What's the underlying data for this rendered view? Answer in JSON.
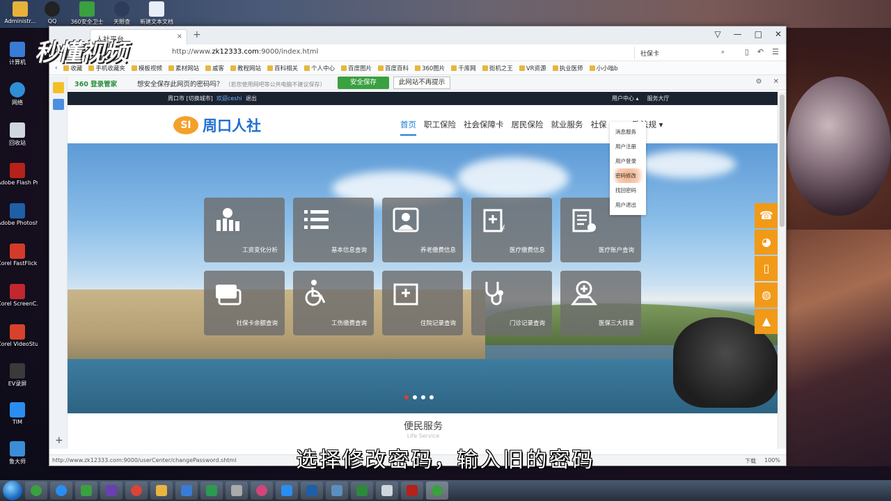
{
  "watermark": "秒懂视频",
  "subtitle": "选择修改密码，输入旧的密码",
  "desktop_icons": [
    {
      "label": "Administr...",
      "color": "#e6b23a"
    },
    {
      "label": "计算机",
      "color": "#3a7bd5"
    },
    {
      "label": "网络",
      "color": "#2e8fd6"
    },
    {
      "label": "回收站",
      "color": "#cfd6de"
    },
    {
      "label": "Adobe Flash Prof...",
      "color": "#b5211b"
    },
    {
      "label": "Adobe Photosh...",
      "color": "#1e5fa8"
    },
    {
      "label": "Corel FastFlick X9",
      "color": "#d43a2a"
    },
    {
      "label": "Corel ScreenC...",
      "color": "#c2262e"
    },
    {
      "label": "Corel VideoStud...",
      "color": "#d8412c"
    },
    {
      "label": "EV录屏",
      "color": "#3a3a3a"
    },
    {
      "label": "TIM",
      "color": "#2a8ef0"
    },
    {
      "label": "鲁大师",
      "color": "#3a8dd6"
    }
  ],
  "desktop_top_icons": [
    {
      "label": "QQ",
      "color": "#333"
    },
    {
      "label": "360安全卫士",
      "color": "#3aa040"
    },
    {
      "label": "天眼查",
      "color": "#2c3c5a"
    },
    {
      "label": "新建文本文档",
      "color": "#e8eef6"
    }
  ],
  "browser": {
    "tab_title": "人社平台",
    "url_prefix": "http://www.",
    "url_domain": "zk12333.com",
    "url_suffix": ":9000/index.html",
    "search_text": "社保卡",
    "favorites": [
      "收藏",
      "手机收藏夹",
      "模板视频",
      "素材网站",
      "戚客",
      "教程网站",
      "百科相关",
      "个人中心",
      "百度图片",
      "百度百科",
      "360图片",
      "千库网",
      "街机之王",
      "VR资源",
      "执业医师",
      "小小嗡b"
    ],
    "save_bar": {
      "brand": "360 登录管家",
      "message": "想安全保存此网页的密码吗？",
      "hint": "（若您使用网吧等公共电脑不建议保存）",
      "save_button": "安全保存",
      "dismiss_button": "此网站不再提示"
    },
    "status_url": "http://www.zk12333.com:9000/userCenter/changePassword.shtml",
    "status_right": [
      "下载",
      "100%"
    ]
  },
  "site": {
    "top_left_city": "周口市",
    "top_left_switch": "[切换城市]",
    "top_left_welcome": "欢迎",
    "top_left_user": "ceshi",
    "top_left_logout": "退出",
    "top_right_user_center": "用户中心",
    "top_right_service": "服务大厅",
    "logo_mark": "SI",
    "logo_text": "周口人社",
    "nav": [
      "首页",
      "职工保险",
      "社会保障卡",
      "居民保险",
      "就业服务",
      "社保",
      "政法规"
    ],
    "dropdown": [
      "消息服务",
      "用户注册",
      "用户登录",
      "密码修改",
      "找回密码",
      "用户退出"
    ],
    "tiles": [
      "工资变化分析",
      "基本信息查询",
      "养老缴费信息",
      "医疗缴费信息",
      "医疗账户查询",
      "社保卡余额查询",
      "工伤缴费查询",
      "住院记录查询",
      "门诊记录查询",
      "医保三大目录"
    ],
    "section_title": "便民服务",
    "section_sub": "Life Service"
  },
  "taskbar_apps": [
    {
      "name": "start",
      "color": "#1d6fc4"
    },
    {
      "name": "360-browser",
      "color": "#3aa040"
    },
    {
      "name": "ie",
      "color": "#2a8ef0"
    },
    {
      "name": "360-safe",
      "color": "#3aa040"
    },
    {
      "name": "media-player",
      "color": "#6a3fb0"
    },
    {
      "name": "chrome",
      "color": "#db4437"
    },
    {
      "name": "folder",
      "color": "#e8b640"
    },
    {
      "name": "network",
      "color": "#3a7bd5"
    },
    {
      "name": "player",
      "color": "#2c9a50"
    },
    {
      "name": "camera",
      "color": "#aaaaaa"
    },
    {
      "name": "flower",
      "color": "#d2467a"
    },
    {
      "name": "tim",
      "color": "#2a8ef0"
    },
    {
      "name": "photoshop",
      "color": "#1e5fa8"
    },
    {
      "name": "tool",
      "color": "#5a8fc0"
    },
    {
      "name": "excel",
      "color": "#2c8a3c"
    },
    {
      "name": "notepad",
      "color": "#d0d6de"
    },
    {
      "name": "flash",
      "color": "#b5211b"
    },
    {
      "name": "360-browser-active",
      "color": "#3aa040"
    }
  ]
}
